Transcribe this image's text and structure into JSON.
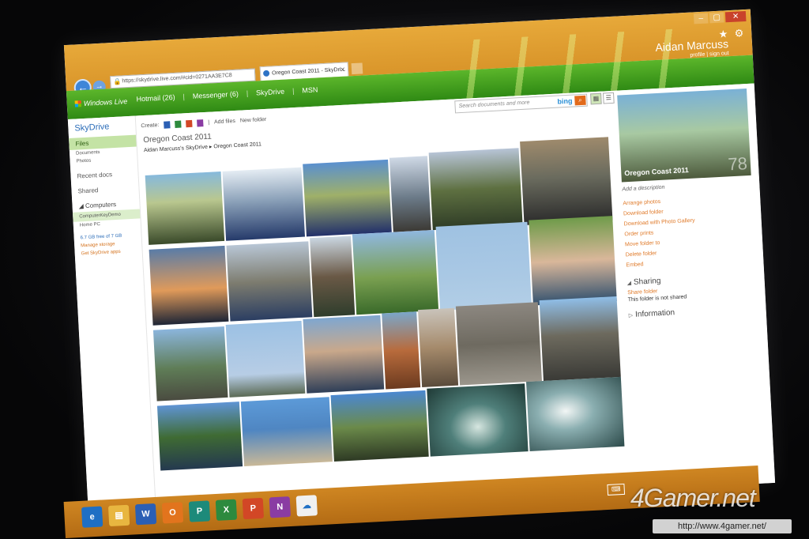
{
  "browser": {
    "address": "https://skydrive.live.com/#cid=0271AA3E7C8",
    "tab_title": "Oregon Coast 2011 - SkyDri...",
    "status_url": "https://skydrive.live.com/#cid=0271AA3E7C8AE888&did=http%3A%2F%2Fpvt-act-3-blu.mesh.com%2Fs%2FMIJUA27BOD6R..."
  },
  "header": {
    "logo": "Windows Live",
    "nav": [
      "Hotmail (26)",
      "Messenger (6)",
      "SkyDrive",
      "MSN"
    ],
    "user_name": "Aidan Marcuss",
    "user_links": "profile | sign out"
  },
  "sidebar": {
    "brand": "SkyDrive",
    "items": [
      "Files",
      "Documents",
      "Photos",
      "Recent docs",
      "Shared"
    ],
    "computers_label": "Computers",
    "computers": [
      "ComputerKeyDemo",
      "Home PC"
    ],
    "storage_text": "6.7 GB free of 7 GB",
    "manage_storage": "Manage storage",
    "get_apps": "Get SkyDrive apps"
  },
  "toolbar": {
    "create_label": "Create:",
    "add_files": "Add files",
    "new_folder": "New folder",
    "search_placeholder": "Search documents and more",
    "bing": "bing"
  },
  "folder": {
    "title": "Oregon Coast 2011",
    "breadcrumb_owner": "Aidan Marcuss's SkyDrive",
    "breadcrumb_sep": "▸",
    "breadcrumb_current": "Oregon Coast 2011"
  },
  "details": {
    "cover_title": "Oregon Coast 2011",
    "count": "78",
    "add_description": "Add a description",
    "actions": [
      "Arrange photos",
      "Download folder",
      "Download with Photo Gallery",
      "Order prints",
      "Move folder to",
      "Delete folder",
      "Embed"
    ],
    "sharing_label": "Sharing",
    "share_folder": "Share folder",
    "not_shared": "This folder is not shared",
    "information_label": "Information"
  },
  "taskbar": {
    "apps": [
      "IE",
      "Explorer",
      "Word",
      "Outlook",
      "Publisher",
      "Excel",
      "PowerPoint",
      "OneNote",
      "Live"
    ]
  },
  "watermark": {
    "brand": "4Gamer.net",
    "url": "http://www.4gamer.net/"
  },
  "colors": {
    "chrome": "#d9952a",
    "header_green": "#2f8a14",
    "link_orange": "#e07b2b",
    "link_blue": "#2a6cb8"
  }
}
